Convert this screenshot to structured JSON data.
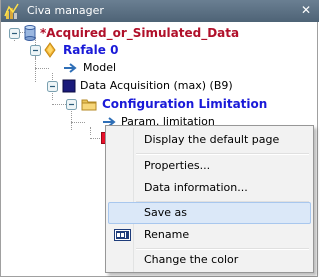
{
  "window": {
    "title": "Civa manager",
    "close_glyph": "✕"
  },
  "tree": {
    "root": {
      "label": "*Acquired_or_Simulated_Data",
      "icon": "cylinder-icon"
    },
    "rafale": {
      "label": "Rafale 0",
      "icon": "diamond-icon"
    },
    "model": {
      "label": "Model",
      "icon": "arrow-right-icon"
    },
    "acquisition": {
      "label": "Data Acquisition (max) (B9)",
      "icon": "square-icon"
    },
    "config": {
      "label": "Configuration Limitation",
      "icon": "folder-icon"
    },
    "param": {
      "label": "Param. limitation",
      "icon": "arrow-right-icon"
    },
    "selected_item": {
      "icon": "red-square-icon"
    }
  },
  "context_menu": {
    "items": [
      {
        "label": "Display the default page"
      },
      {
        "label": "Properties..."
      },
      {
        "label": "Data information..."
      },
      {
        "label": "Save as"
      },
      {
        "label": "Rename",
        "icon": "rename-icon"
      },
      {
        "label": "Change the color"
      }
    ]
  },
  "colors": {
    "titlebar": "#5a6f82",
    "root_label": "#b0102a",
    "blue_label": "#1a1ad8",
    "menu_hover": "#dbe8f8"
  }
}
